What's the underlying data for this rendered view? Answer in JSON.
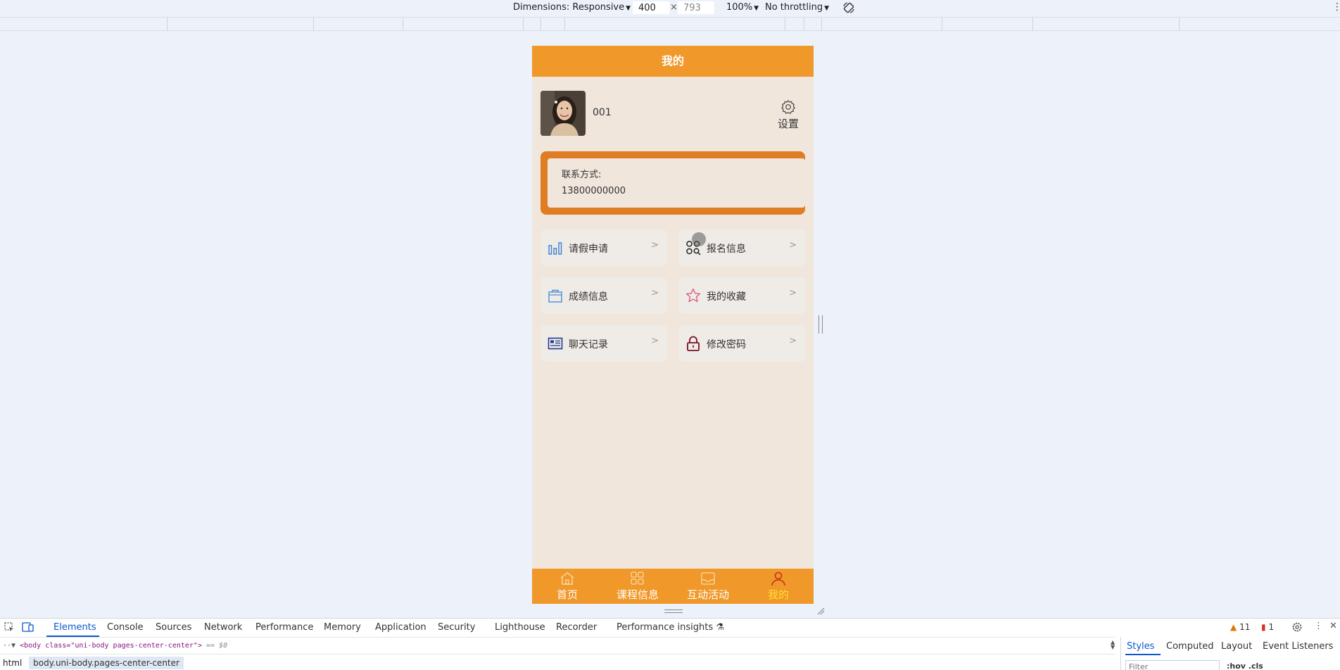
{
  "devtools_toolbar": {
    "dimensions_label": "Dimensions: Responsive",
    "width_value": "400",
    "height_value": "793",
    "zoom": "100%",
    "throttling": "No throttling"
  },
  "app": {
    "header_title": "我的",
    "profile": {
      "username": "001",
      "settings_label": "设置"
    },
    "contact": {
      "label": "联系方式:",
      "value": "13800000000"
    },
    "menu": [
      {
        "label": "请假申请",
        "icon": "bar-chart-icon",
        "arrow": ">"
      },
      {
        "label": "报名信息",
        "icon": "grid-search-icon",
        "arrow": ">"
      },
      {
        "label": "成绩信息",
        "icon": "bag-icon",
        "arrow": ">"
      },
      {
        "label": "我的收藏",
        "icon": "star-icon",
        "arrow": ">"
      },
      {
        "label": "聊天记录",
        "icon": "card-icon",
        "arrow": ">"
      },
      {
        "label": "修改密码",
        "icon": "lock-icon",
        "arrow": ">"
      }
    ],
    "tabbar": [
      {
        "label": "首页",
        "icon": "home-icon"
      },
      {
        "label": "课程信息",
        "icon": "grid-icon"
      },
      {
        "label": "互动活动",
        "icon": "inbox-icon"
      },
      {
        "label": "我的",
        "icon": "user-icon",
        "active": true
      }
    ],
    "colors": {
      "primary": "#f0982a",
      "contact_border": "#e07c24",
      "background": "#f0e6dc",
      "active_tab": "#ffe033"
    }
  },
  "devtools_panel": {
    "tabs": [
      "Elements",
      "Console",
      "Sources",
      "Network",
      "Performance",
      "Memory",
      "Application",
      "Security",
      "Lighthouse",
      "Recorder",
      "Performance insights"
    ],
    "active_tab": "Elements",
    "warnings_count": "11",
    "errors_count": "1",
    "dom_line": "<body class=\"uni-body pages-center-center\">",
    "dom_suffix": "== $0",
    "breadcrumb_root": "html",
    "breadcrumb_active": "body.uni-body.pages-center-center",
    "styles_tabs": [
      "Styles",
      "Computed",
      "Layout",
      "Event Listeners"
    ],
    "filter_placeholder": "Filter",
    "hov_cls": ":hov  .cls"
  }
}
